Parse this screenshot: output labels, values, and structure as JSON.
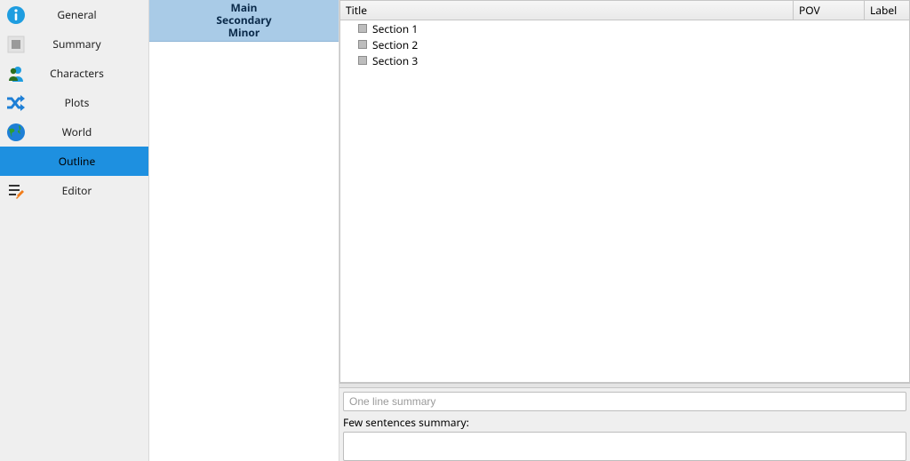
{
  "sidebar": {
    "items": [
      {
        "id": "general",
        "label": "General",
        "icon": "info-icon",
        "active": false
      },
      {
        "id": "summary",
        "label": "Summary",
        "icon": "square-icon",
        "active": false
      },
      {
        "id": "characters",
        "label": "Characters",
        "icon": "person-icon",
        "active": false
      },
      {
        "id": "plots",
        "label": "Plots",
        "icon": "shuffle-icon",
        "active": false
      },
      {
        "id": "world",
        "label": "World",
        "icon": "globe-icon",
        "active": false
      },
      {
        "id": "outline",
        "label": "Outline",
        "icon": "",
        "active": true
      },
      {
        "id": "editor",
        "label": "Editor",
        "icon": "edit-icon",
        "active": false
      }
    ]
  },
  "midcol": {
    "header": [
      "Main",
      "Secondary",
      "Minor"
    ]
  },
  "tree": {
    "columns": {
      "title": "Title",
      "pov": "POV",
      "label": "Label"
    },
    "rows": [
      {
        "title": "Section 1"
      },
      {
        "title": "Section 2"
      },
      {
        "title": "Section 3"
      }
    ]
  },
  "summary_pane": {
    "one_line_placeholder": "One line summary",
    "few_sentences_label": "Few sentences summary:"
  }
}
